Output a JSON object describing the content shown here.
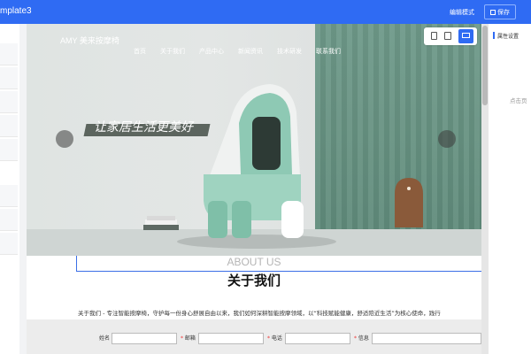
{
  "app": {
    "title": "mplate3"
  },
  "toolbar": {
    "mode_label": "编辑模式",
    "save_label": "保存"
  },
  "site": {
    "logo": "AMY 美来按摩椅",
    "nav": [
      "首页",
      "关于我们",
      "产品中心",
      "新闻资讯",
      "技术研发",
      "联系我们"
    ],
    "slogan": "让家居生活更美好",
    "about_en": "ABOUT US",
    "about_cn": "关于我们",
    "about_text": "关于我们 - 专注智能按摩椅，守护每一份身心舒展自由以来，我们如何深耕智能按摩领域，以“科技赋能健康，舒适陪近生活”为核心使命，践行"
  },
  "form": {
    "fields": [
      "姓名",
      "邮箱",
      "电话",
      "信息"
    ]
  },
  "device_switch": {
    "options": [
      "mobile-icon",
      "tablet-icon",
      "desktop-icon"
    ],
    "active": "desktop-icon"
  },
  "right_panel": {
    "title": "属性设置",
    "hint": "点击页"
  },
  "colors": {
    "accent": "#2f6bf3",
    "chair": "#8ec9b4",
    "wall": "#6f9a8a"
  }
}
